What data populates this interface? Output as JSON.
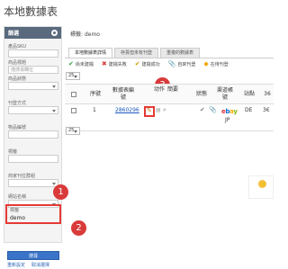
{
  "page": {
    "title": "本地數據表"
  },
  "sidebar": {
    "title": "篩選",
    "fields": [
      {
        "label": "產品SKU",
        "placeholder": ""
      },
      {
        "label": "商品標題",
        "placeholder": "僅搜尋欄位"
      },
      {
        "label": "商品狀態",
        "placeholder": ""
      },
      {
        "label": "刊登方式",
        "placeholder": ""
      },
      {
        "label": "物品編號",
        "placeholder": ""
      },
      {
        "label": "標籤",
        "placeholder": ""
      },
      {
        "label": "商家刊位群組",
        "placeholder": ""
      },
      {
        "label": "網站名稱",
        "placeholder": ""
      }
    ],
    "tag_label": "標籤",
    "tag_value": "demo",
    "search_button": "搜尋",
    "links": [
      "重新設定",
      "取消選擇"
    ]
  },
  "main": {
    "tag_filter_label": "標籤",
    "tag_filter_value": "demo",
    "tabs": [
      {
        "label": "本地數據表詳情",
        "active": true
      },
      {
        "label": "存貨但未有刊登",
        "active": false
      },
      {
        "label": "重複的數據表",
        "active": false
      }
    ],
    "statuses": [
      {
        "icon": "check-icon",
        "label": "尚未建檔",
        "color": "#2e9e3e"
      },
      {
        "icon": "cross-icon",
        "label": "建檔失敗",
        "color": "#d93a3a"
      },
      {
        "icon": "check-icon",
        "label": "建檔成功",
        "color": "#c9a100"
      },
      {
        "icon": "clip-icon",
        "label": "自來刊登",
        "color": "#666666"
      },
      {
        "icon": "tag-icon",
        "label": "在待刊登",
        "color": "#f0a800"
      }
    ],
    "per_page": "25",
    "per_page_bottom": "25",
    "columns": [
      "序號",
      "數據表編號",
      "动作",
      "簡要",
      "狀態",
      "渠道帳號",
      "站點",
      "36"
    ],
    "rows": [
      {
        "index": "1",
        "id": "2860296",
        "status": "",
        "site": "DE",
        "channel": "ebay",
        "channel_region": "JP",
        "extra": "3€"
      }
    ]
  },
  "annotations": {
    "badge1": "1",
    "badge2": "2",
    "badge3": "3"
  },
  "colors": {
    "highlight": "#e53935",
    "badge": "#d93a3a",
    "button": "#3a74c8",
    "sidebar_header": "#5a6a7e"
  }
}
